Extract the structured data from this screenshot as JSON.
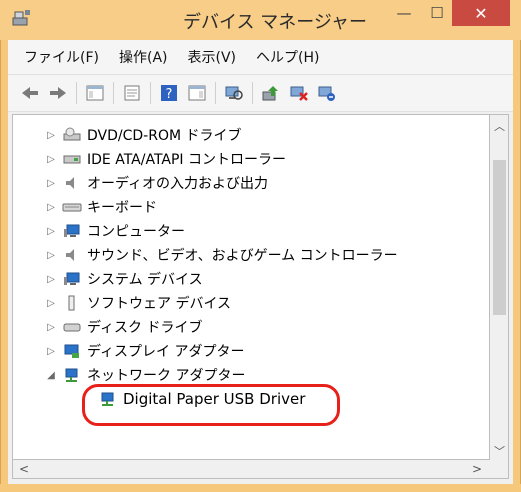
{
  "window": {
    "title": "デバイス マネージャー",
    "min_icon": "—",
    "max_icon": "☐",
    "close_icon": "✕"
  },
  "menu": [
    "ファイル(F)",
    "操作(A)",
    "表示(V)",
    "ヘルプ(H)"
  ],
  "toolbar": {
    "buttons": [
      "back-arrow-icon",
      "forward-arrow-icon",
      "show-hide-console-tree-icon",
      "properties-icon",
      "help-icon",
      "show-action-pane-icon",
      "scan-hardware-icon",
      "update-driver-icon",
      "disable-device-icon",
      "uninstall-device-icon"
    ]
  },
  "tree": {
    "items": [
      {
        "label": "DVD/CD-ROM ドライブ",
        "icon": "dvd-drive-icon",
        "expanded": false
      },
      {
        "label": "IDE ATA/ATAPI コントローラー",
        "icon": "ide-controller-icon",
        "expanded": false
      },
      {
        "label": "オーディオの入力および出力",
        "icon": "audio-icon",
        "expanded": false
      },
      {
        "label": "キーボード",
        "icon": "keyboard-icon",
        "expanded": false
      },
      {
        "label": "コンピューター",
        "icon": "computer-icon",
        "expanded": false
      },
      {
        "label": "サウンド、ビデオ、およびゲーム コントローラー",
        "icon": "sound-icon",
        "expanded": false
      },
      {
        "label": "システム デバイス",
        "icon": "system-devices-icon",
        "expanded": false
      },
      {
        "label": "ソフトウェア デバイス",
        "icon": "software-device-icon",
        "expanded": false
      },
      {
        "label": "ディスク ドライブ",
        "icon": "disk-drive-icon",
        "expanded": false
      },
      {
        "label": "ディスプレイ アダプター",
        "icon": "display-adapter-icon",
        "expanded": false
      },
      {
        "label": "ネットワーク アダプター",
        "icon": "network-adapter-icon",
        "expanded": true
      },
      {
        "label": "Digital Paper USB Driver",
        "icon": "network-device-icon",
        "expanded": null
      }
    ]
  },
  "colors": {
    "frame": "#f6c87c",
    "close_button": "#c94a40",
    "highlight": "#e8201a"
  }
}
